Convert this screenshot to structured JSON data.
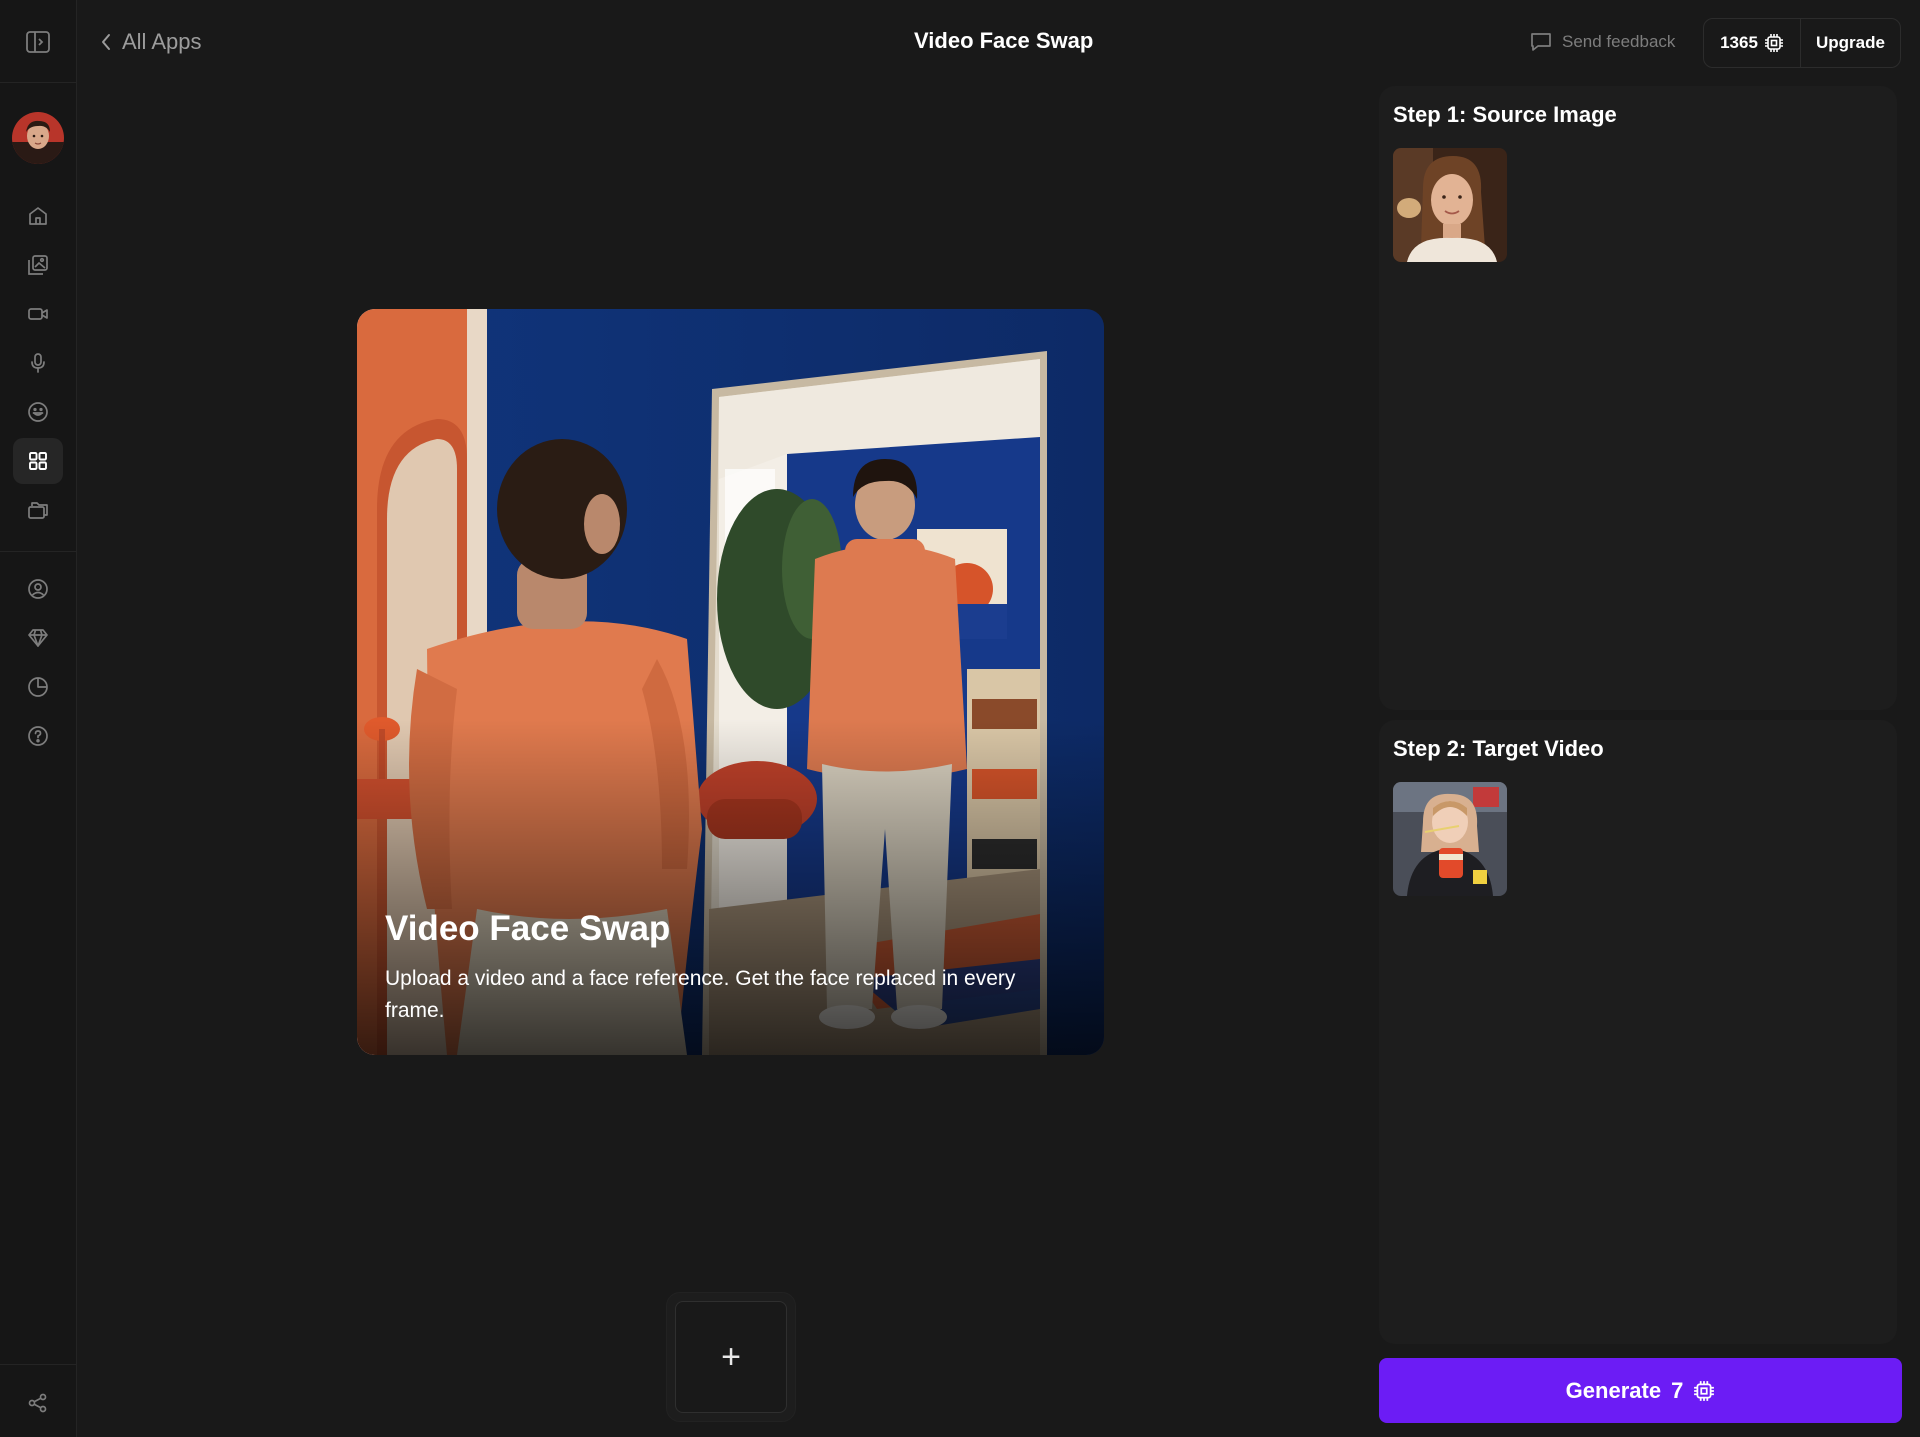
{
  "header": {
    "back_label": "All Apps",
    "title": "Video Face Swap",
    "feedback_label": "Send feedback",
    "credits": "1365",
    "upgrade_label": "Upgrade"
  },
  "sidebar": {
    "items": [
      {
        "name": "home",
        "icon": "home-icon"
      },
      {
        "name": "images",
        "icon": "images-icon"
      },
      {
        "name": "video",
        "icon": "video-icon"
      },
      {
        "name": "audio",
        "icon": "microphone-icon"
      },
      {
        "name": "avatars",
        "icon": "face-icon"
      },
      {
        "name": "apps",
        "icon": "apps-grid-icon",
        "active": true
      },
      {
        "name": "library",
        "icon": "folder-icon"
      },
      {
        "name": "profile",
        "icon": "user-circle-icon"
      },
      {
        "name": "plans",
        "icon": "diamond-icon"
      },
      {
        "name": "usage",
        "icon": "pie-chart-icon"
      },
      {
        "name": "help",
        "icon": "help-icon"
      },
      {
        "name": "share",
        "icon": "share-icon"
      }
    ]
  },
  "hero": {
    "title": "Video Face Swap",
    "description": "Upload a video and a face reference. Get the face replaced in every frame."
  },
  "add_button": {
    "label": "+"
  },
  "steps": [
    {
      "title": "Step 1: Source Image"
    },
    {
      "title": "Step 2: Target Video"
    }
  ],
  "generate": {
    "label": "Generate",
    "cost": "7"
  },
  "colors": {
    "accent": "#6c1cf5",
    "background": "#191919",
    "panel": "#1d1d1d"
  }
}
